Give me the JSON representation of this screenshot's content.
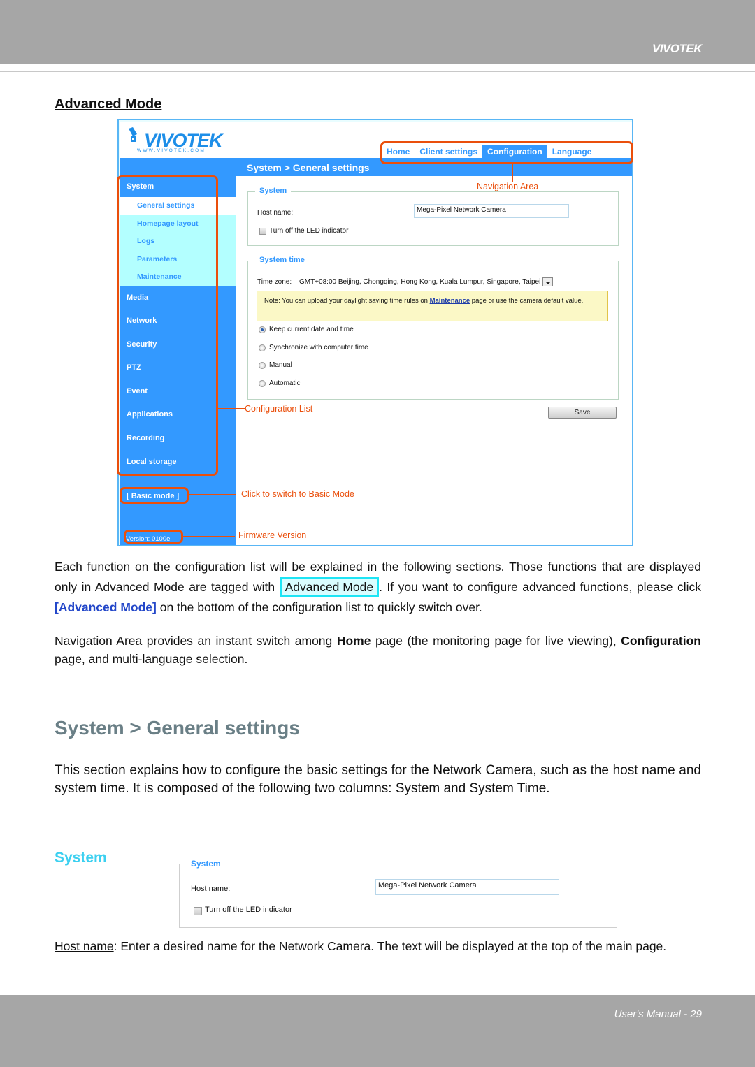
{
  "manual": {
    "header_brand": "VIVOTEK",
    "footer": "User's Manual - 29",
    "advanced_heading": "Advanced Mode"
  },
  "screenshot": {
    "logo": "VIVOTEK",
    "logo_url": "WWW.VIVOTEK.COM",
    "breadcrumb": "System  > General settings",
    "nav": [
      {
        "label": "Home",
        "active": false
      },
      {
        "label": "Client settings",
        "active": false
      },
      {
        "label": "Configuration",
        "active": true
      },
      {
        "label": "Language",
        "active": false
      }
    ],
    "sidebar": {
      "system_label": "System",
      "system_sub": [
        "General settings",
        "Homepage layout",
        "Logs",
        "Parameters",
        "Maintenance"
      ],
      "items": [
        "Media",
        "Network",
        "Security",
        "PTZ",
        "Event",
        "Applications",
        "Recording",
        "Local storage"
      ],
      "basic_mode": "[ Basic mode ]",
      "version": "Version: 0100e"
    },
    "system_section": {
      "legend": "System",
      "host_label": "Host name:",
      "host_value": "Mega-Pixel Network Camera",
      "led_label": "Turn off the LED indicator",
      "led_checked": false
    },
    "time_section": {
      "legend": "System time",
      "tz_label": "Time zone:",
      "tz_value": "GMT+08:00 Beijing, Chongqing, Hong Kong, Kuala Lumpur, Singapore, Taipei",
      "note_pre": "Note: You can upload your daylight saving time rules on ",
      "note_link": "Maintenance",
      "note_post": " page or use the camera default value.",
      "options": [
        "Keep current date and time",
        "Synchronize with computer time",
        "Manual",
        "Automatic"
      ],
      "selected_option": "Keep current date and time"
    },
    "save_label": "Save",
    "annotations": {
      "navigation_area": "Navigation Area",
      "configuration_list": "Configuration List",
      "basic_mode": "Click to switch to Basic Mode",
      "firmware": "Firmware Version"
    }
  },
  "text": {
    "p1_a": "Each function on the configuration list will be explained in the following sections. Those functions that are displayed only in Advanced Mode are tagged with ",
    "p1_tag": "Advanced Mode",
    "p1_b": ". If you want to configure advanced functions, please click ",
    "p1_link": "[Advanced Mode]",
    "p1_c": " on the bottom of the configuration list to quickly switch over.",
    "p2_a": "Navigation Area provides an instant switch among ",
    "p2_home": "Home",
    "p2_b": " page (the monitoring page for live viewing), ",
    "p2_conf": "Configuration",
    "p2_c": " page, and multi-language selection.",
    "section_title": "System > General settings",
    "p3": "This section explains how to configure the basic settings for the Network Camera, such as the host name and system time. It is composed of the following two columns: System and System Time.",
    "subsection_title": "System",
    "p4_term": "Host name",
    "p4_rest": ": Enter a desired name for the Network Camera. The text will be displayed at the top of the main page."
  },
  "bottom_shot": {
    "legend": "System",
    "host_label": "Host name:",
    "host_value": "Mega-Pixel Network Camera",
    "led_label": "Turn off the LED indicator"
  }
}
